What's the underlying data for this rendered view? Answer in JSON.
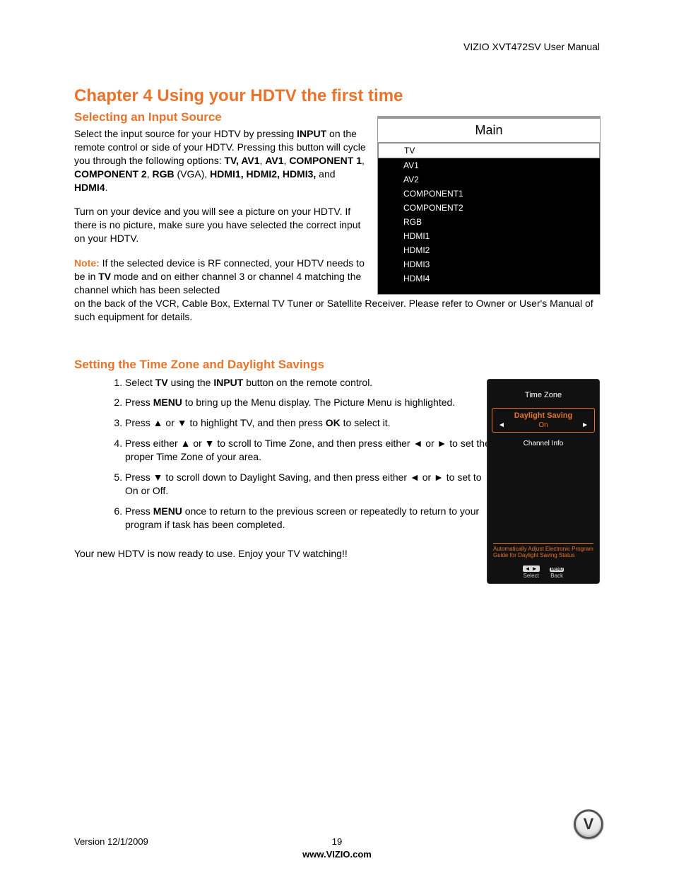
{
  "header": {
    "product": "VIZIO XVT472SV User Manual"
  },
  "chapter": {
    "title": "Chapter 4 Using your HDTV the first time"
  },
  "section1": {
    "title": "Selecting an Input Source",
    "p1a": "Select the input source for your HDTV by pressing ",
    "p1b_bold": "INPUT",
    "p1c": " on the remote control or side of your HDTV.  Pressing this button will cycle you through the following options: ",
    "p1d_bold": "TV, AV1",
    "p1d_comma": ", ",
    "p1e_bold": "AV1",
    "p1f_bold": "COMPONENT 1",
    "p1g_bold": "COMPONENT 2",
    "p1h_bold": "RGB",
    "p1i": " (VGA), ",
    "p1j_bold": "HDMI1, HDMI2, HDMI3,",
    "p1k": " and ",
    "p1l_bold": "HDMI4",
    "p1m": ".",
    "p2": "Turn on your device and you will see a picture on your HDTV. If there is no picture, make sure you have selected the correct input on your HDTV.",
    "note_label": "Note:",
    "note1": " If the selected device is RF connected, your HDTV needs to be in ",
    "note_tv": "TV",
    "note2": " mode and on either channel 3 or channel 4 matching the channel which has been selected",
    "note_full": "on the back of the VCR, Cable Box, External TV Tuner or Satellite Receiver. Please refer to Owner or User's Manual of such equipment for details."
  },
  "main_menu": {
    "title": "Main",
    "items": [
      "TV",
      "AV1",
      "AV2",
      "COMPONENT1",
      "COMPONENT2",
      "RGB",
      "HDMI1",
      "HDMI2",
      "HDMI3",
      "HDMI4"
    ]
  },
  "section2": {
    "title": "Setting the Time Zone and Daylight Savings",
    "steps": [
      {
        "pre": "Select ",
        "b1": "TV",
        "mid": " using the ",
        "b2": "INPUT",
        "post": " button on the remote control."
      },
      {
        "pre": "Press ",
        "b1": "MENU",
        "post": " to bring up the Menu display. The Picture Menu is highlighted."
      },
      {
        "pre": "Press ▲ or ▼ to highlight TV, and then press ",
        "b1": "OK",
        "post": " to select it."
      },
      {
        "pre": "Press either ▲ or ▼ to scroll to Time Zone, and then press either ◄ or ► to set the proper Time Zone of your area."
      },
      {
        "pre": "Press ▼ to scroll down to Daylight Saving, and then press either ◄ or ► to set to On or Off."
      },
      {
        "pre": "Press ",
        "b1": "MENU",
        "post": " once to return to the previous screen or repeatedly to return to your program if task has been completed."
      }
    ],
    "closing": "Your new HDTV is now ready to use. Enjoy your TV watching!!"
  },
  "tz_menu": {
    "title": "Time Zone",
    "sel_label": "Daylight Saving",
    "sel_value": "On",
    "row2": "Channel Info",
    "help": "Automatically Adjust Electronic Program Guide for Daylight Saving Status",
    "btn1_icon": "◄ ►",
    "btn1_label": "Select",
    "btn2_icon": "MENU",
    "btn2_label": "Back"
  },
  "footer": {
    "version": "Version 12/1/2009",
    "page": "19",
    "url": "www.VIZIO.com"
  },
  "logo": {
    "letter": "V"
  }
}
